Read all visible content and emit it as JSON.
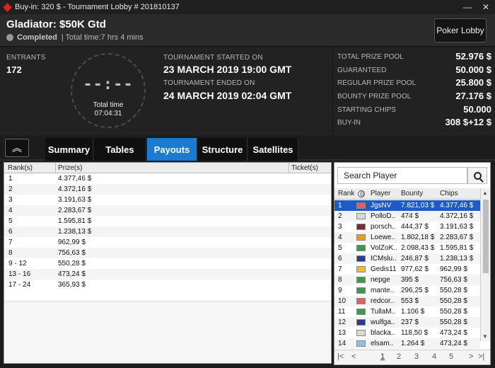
{
  "window": {
    "title": "Buy-in: 320 $ - Tournament Lobby # 201810137",
    "minimize": "—",
    "close": "✕"
  },
  "header": {
    "name": "Gladiator: $50K Gtd",
    "status": "Completed",
    "total_time": "| Total time:7 hrs  4 mins",
    "lobby_button": "Poker Lobby"
  },
  "info": {
    "entrants_label": "ENTRANTS",
    "entrants": "172",
    "clock_digits": "--:--",
    "clock_label": "Total time",
    "clock_value": "07:04:31",
    "started_label": "TOURNAMENT STARTED ON",
    "started": "23 MARCH 2019  19:00 GMT",
    "ended_label": "TOURNAMENT ENDED ON",
    "ended": "24 MARCH 2019  02:04 GMT"
  },
  "prize": [
    {
      "label": "TOTAL PRIZE POOL",
      "value": "52.976 $"
    },
    {
      "label": "GUARANTEED",
      "value": "50.000 $"
    },
    {
      "label": "REGULAR PRIZE POOL",
      "value": "25.800 $"
    },
    {
      "label": "BOUNTY PRIZE POOL",
      "value": "27.176 $"
    },
    {
      "label": "STARTING CHIPS",
      "value": "50.000"
    },
    {
      "label": "BUY-IN",
      "value": "308 $+12 $"
    }
  ],
  "tabs": {
    "collapse": "︽",
    "items": [
      "Summary",
      "Tables",
      "Payouts",
      "Structure",
      "Satellites"
    ],
    "active": "Payouts"
  },
  "payouts": {
    "columns": [
      "Rank(s)",
      "Prize(s)",
      "Ticket(s)"
    ],
    "rows": [
      [
        "1",
        "4.377,46 $"
      ],
      [
        "2",
        "4.372,16 $"
      ],
      [
        "3",
        "3.191,63 $"
      ],
      [
        "4",
        "2.283,67 $"
      ],
      [
        "5",
        "1.595,81 $"
      ],
      [
        "6",
        "1.238,13 $"
      ],
      [
        "7",
        "962,99 $"
      ],
      [
        "8",
        "756,63 $"
      ],
      [
        "9 - 12",
        "550,28 $"
      ],
      [
        "13 - 16",
        "473,24 $"
      ],
      [
        "17 - 24",
        "365,93 $"
      ]
    ]
  },
  "players": {
    "search_placeholder": "Search Player",
    "columns": [
      "Rank",
      "Player",
      "Bounty",
      "Chips"
    ],
    "rows": [
      {
        "rank": "1",
        "player": "JgsNV",
        "bounty": "7.821,03 $",
        "chips": "4.377,46 $",
        "flag": "#e06060"
      },
      {
        "rank": "2",
        "player": "PolloD..",
        "bounty": "474 $",
        "chips": "4.372,16 $",
        "flag": "#d9d9d9"
      },
      {
        "rank": "3",
        "player": "porsch..",
        "bounty": "444,37 $",
        "chips": "3.191,63 $",
        "flag": "#7a2a35"
      },
      {
        "rank": "4",
        "player": "Loewe..",
        "bounty": "1.802,18 $",
        "chips": "2.283,67 $",
        "flag": "#e0a020"
      },
      {
        "rank": "5",
        "player": "VolZoK..",
        "bounty": "2.098,43 $",
        "chips": "1.595,81 $",
        "flag": "#3b9b4b"
      },
      {
        "rank": "6",
        "player": "ICMslu..",
        "bounty": "246,87 $",
        "chips": "1.238,13 $",
        "flag": "#2a3b8f"
      },
      {
        "rank": "7",
        "player": "Gedis11",
        "bounty": "977,62 $",
        "chips": "962,99 $",
        "flag": "#e8c020"
      },
      {
        "rank": "8",
        "player": "nepge",
        "bounty": "395 $",
        "chips": "756,63 $",
        "flag": "#3b9b4b"
      },
      {
        "rank": "9",
        "player": "mante..",
        "bounty": "296,25 $",
        "chips": "550,28 $",
        "flag": "#3b9b4b"
      },
      {
        "rank": "10",
        "player": "redcor..",
        "bounty": "553 $",
        "chips": "550,28 $",
        "flag": "#e06060"
      },
      {
        "rank": "11",
        "player": "TullaM..",
        "bounty": "1.106 $",
        "chips": "550,28 $",
        "flag": "#3b9b4b"
      },
      {
        "rank": "12",
        "player": "wulfga..",
        "bounty": "237 $",
        "chips": "550,28 $",
        "flag": "#2a3b8f"
      },
      {
        "rank": "13",
        "player": "blacka..",
        "bounty": "118,50 $",
        "chips": "473,24 $",
        "flag": "#d9d9d9"
      },
      {
        "rank": "14",
        "player": "elsam..",
        "bounty": "1.264 $",
        "chips": "473,24 $",
        "flag": "#8fc0e0"
      }
    ],
    "selected_rank": "1",
    "pager": {
      "first": "|<",
      "prev": "<",
      "pages": [
        "1",
        "2",
        "3",
        "4",
        "5"
      ],
      "current": "1",
      "next": ">",
      "last": ">|"
    }
  },
  "colors": {
    "accent_tab": "#1a7bd0",
    "selected_row": "#1f5bc4"
  }
}
